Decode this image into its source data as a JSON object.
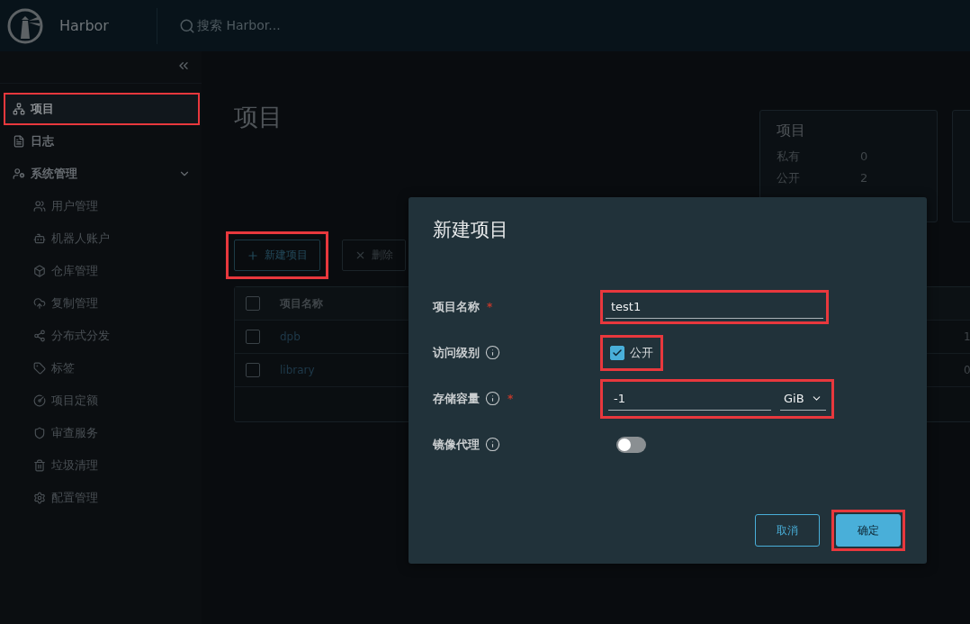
{
  "header": {
    "brand": "Harbor",
    "search": {
      "placeholder": "搜索 Harbor..."
    }
  },
  "sidebar": {
    "items": [
      {
        "label": "项目",
        "selected": true,
        "highlighted": true
      },
      {
        "label": "日志",
        "selected": false,
        "highlighted": false
      },
      {
        "label": "系统管理",
        "selected": false,
        "highlighted": false,
        "expanded": true,
        "children": [
          {
            "label": "用户管理",
            "selected": false
          },
          {
            "label": "机器人账户",
            "selected": false
          },
          {
            "label": "仓库管理",
            "selected": false
          },
          {
            "label": "复制管理",
            "selected": false
          },
          {
            "label": "分布式分发",
            "selected": false
          },
          {
            "label": "标签",
            "selected": false
          },
          {
            "label": "项目定额",
            "selected": false
          },
          {
            "label": "审查服务",
            "selected": false
          },
          {
            "label": "垃圾清理",
            "selected": false
          },
          {
            "label": "配置管理",
            "selected": false
          }
        ]
      }
    ]
  },
  "page": {
    "title": "项目",
    "summary": {
      "title": "项目",
      "rows": [
        {
          "label": "私有",
          "value": "0"
        },
        {
          "label": "公开",
          "value": "2"
        }
      ]
    },
    "toolbar": [
      {
        "kind": "add",
        "label": "新建项目",
        "highlighted": true,
        "disabled": false
      },
      {
        "kind": "delete",
        "label": "删除",
        "disabled": true
      }
    ],
    "table": {
      "select_all_checked": false,
      "columns": [
        "项目名称"
      ],
      "rows": [
        {
          "name": "dpb",
          "column_3": "1",
          "checked": false
        },
        {
          "name": "library",
          "column_3": "0",
          "checked": false
        }
      ]
    }
  },
  "dialog": {
    "title": "新建项目",
    "fields": [
      {
        "kind": "text",
        "label": "项目名称",
        "required_mark": "*",
        "value": "test1",
        "highlighted": true
      },
      {
        "kind": "checkbox",
        "label": "访问级别",
        "info": true,
        "checked": true,
        "option": "公开",
        "highlighted": true
      },
      {
        "kind": "quota",
        "label": "存储容量",
        "info": true,
        "required_mark": "*",
        "value": "-1",
        "unit": "GiB",
        "highlighted": true
      },
      {
        "kind": "toggle",
        "label": "镜像代理",
        "info": true,
        "on": false
      }
    ],
    "buttons": [
      {
        "kind": "secondary",
        "label": "取消"
      },
      {
        "kind": "primary",
        "label": "确定",
        "highlighted": true
      }
    ]
  }
}
